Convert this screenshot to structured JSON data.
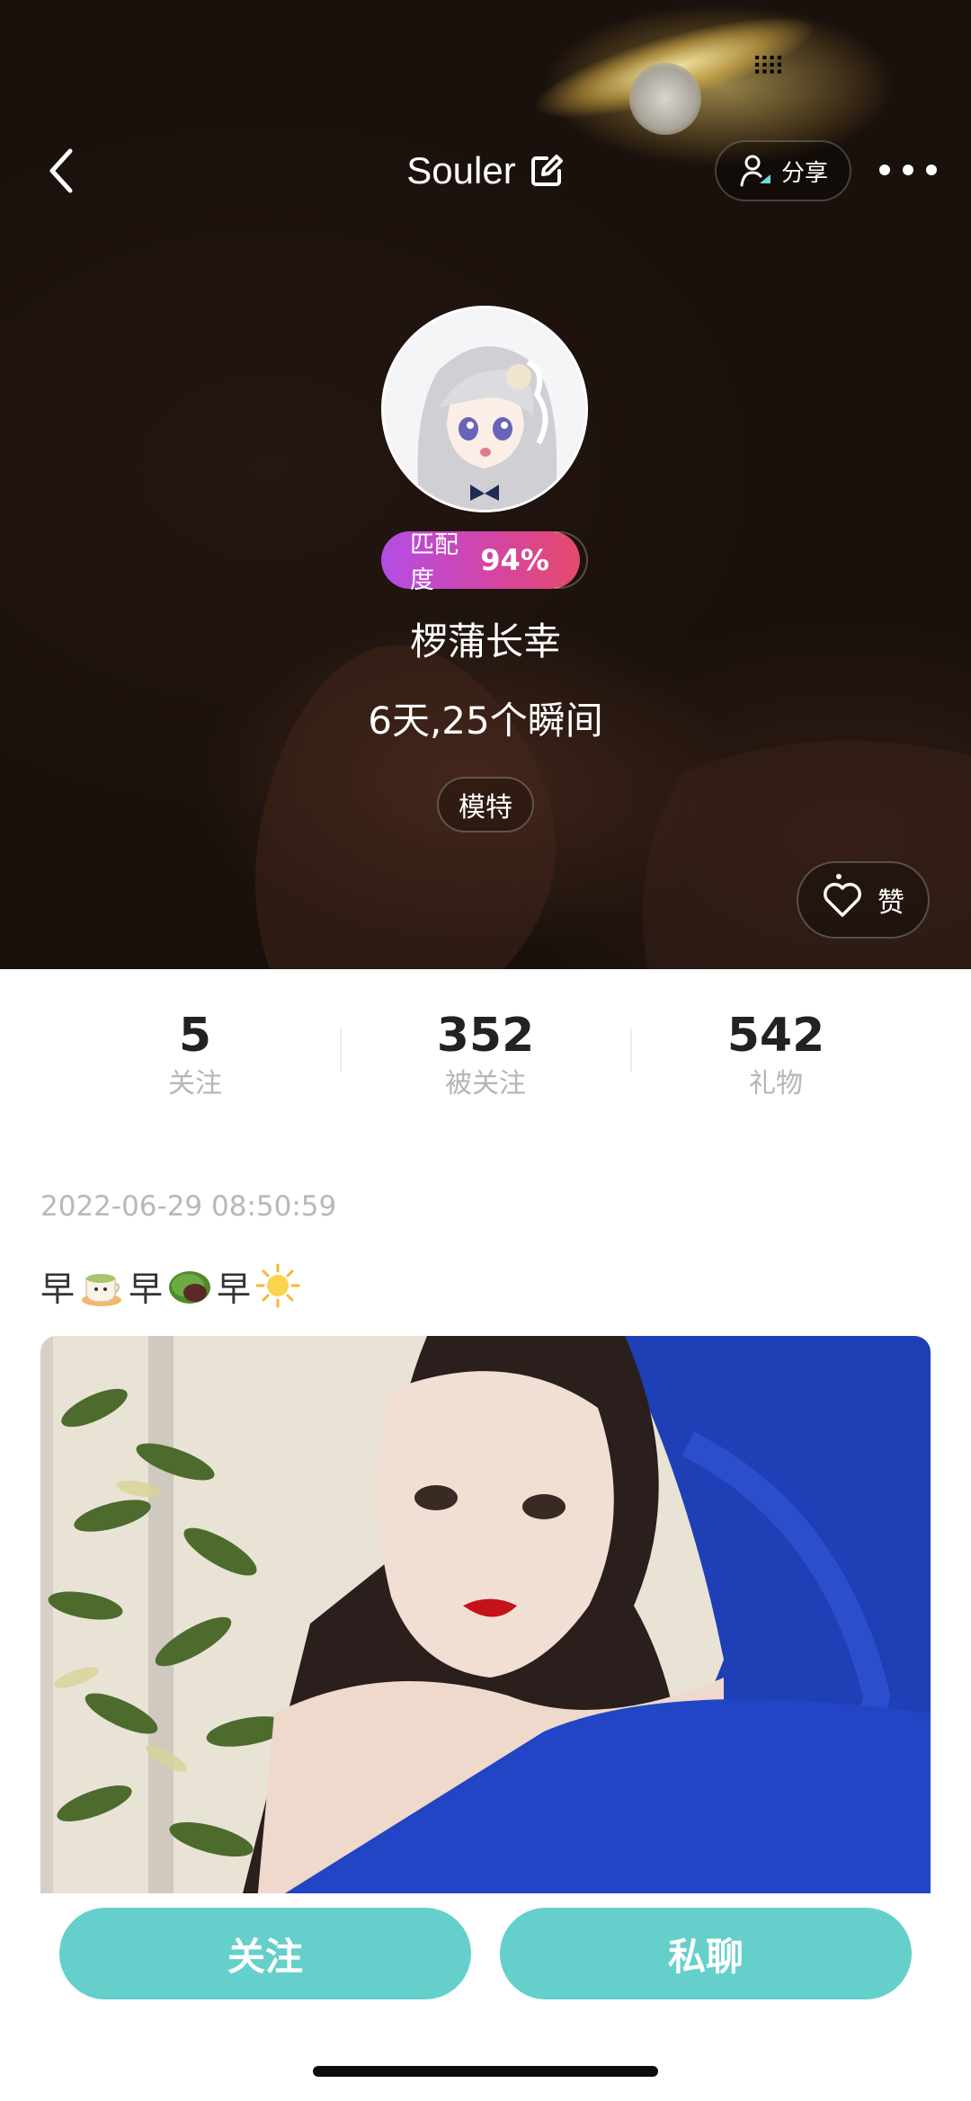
{
  "header": {
    "title": "Souler",
    "share_label": "分享"
  },
  "profile": {
    "match_label": "匹配度",
    "match_value": "94%",
    "username": "椤蒲长幸",
    "summary": "6天,25个瞬间",
    "tag": "模特",
    "like_label": "赞"
  },
  "stats": [
    {
      "value": "5",
      "label": "关注"
    },
    {
      "value": "352",
      "label": "被关注"
    },
    {
      "value": "542",
      "label": "礼物"
    }
  ],
  "post": {
    "timestamp": "2022-06-29 08:50:59",
    "text_parts": [
      "早",
      "早",
      "早"
    ],
    "emojis": [
      "tea-cup-emoji",
      "rice-cake-emoji",
      "sun-emoji"
    ]
  },
  "actions": {
    "follow_label": "关注",
    "chat_label": "私聊"
  },
  "colors": {
    "accent": "#65d0cb",
    "match_gradient_start": "#b34de6",
    "match_gradient_end": "#e54a6a"
  }
}
